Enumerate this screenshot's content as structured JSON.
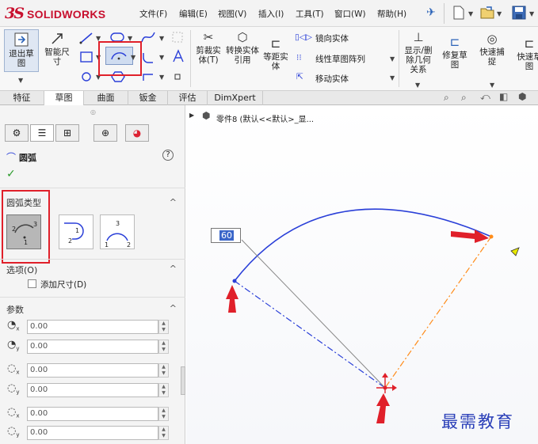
{
  "app": {
    "brand_prefix": "3S",
    "brand_name": "SOLIDWORKS"
  },
  "menubar": {
    "items": [
      "文件(F)",
      "编辑(E)",
      "视图(V)",
      "插入(I)",
      "工具(T)",
      "窗口(W)",
      "帮助(H)"
    ],
    "pin": "✈"
  },
  "ribbon": {
    "exit_sketch": "退出草图",
    "smart_dim": "智能尺寸",
    "trim": "剪裁实体(T)",
    "convert": "转换实体引用",
    "offset": "等距实体",
    "mirror": "镜向实体",
    "linear_pattern": "线性草图阵列",
    "move": "移动实体",
    "show_relations": "显示/删除几何关系",
    "repair": "修复草图",
    "quick_snap": "快速捕捉",
    "quick_view": "快速草图"
  },
  "tabs": [
    "特征",
    "草图",
    "曲面",
    "钣金",
    "评估",
    "DimXpert"
  ],
  "tree": {
    "part": "零件8 (默认<<默认>_显..."
  },
  "panel": {
    "title": "圆弧",
    "help": "?",
    "ok": "✓",
    "arc_type_label": "圆弧类型",
    "options_label": "选项(O)",
    "add_dim": "添加尺寸(D)",
    "params_label": "参数",
    "fields": [
      "0.00",
      "0.00",
      "0.00",
      "0.00",
      "0.00",
      "0.00"
    ]
  },
  "canvas": {
    "dimension": "60",
    "watermark": "最需教育"
  },
  "colors": {
    "highlight": "#e0202a",
    "arc": "#2a3fd8",
    "brand": "#c8102e",
    "construction": "#ff8c1a"
  }
}
